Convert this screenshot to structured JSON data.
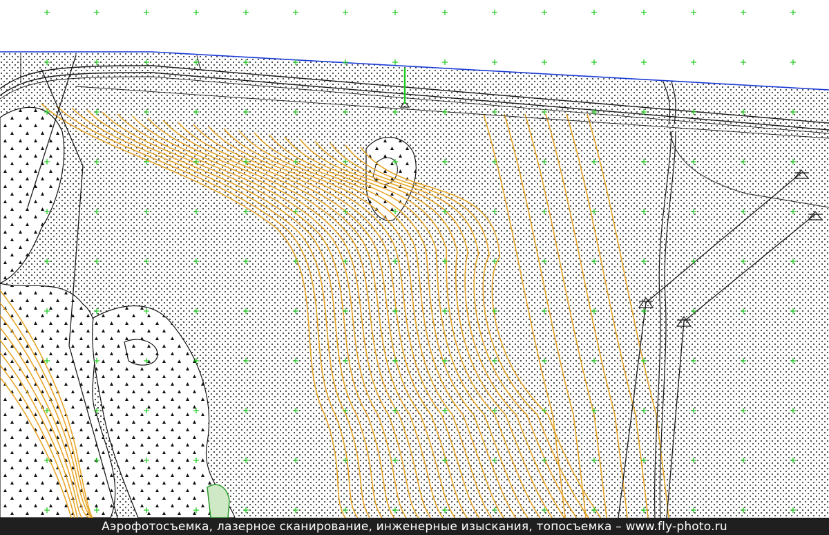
{
  "caption": "Аэрофотосъемка, лазерное сканирование, инженерные изыскания, топосъемка – www.fly-photo.ru",
  "colors": {
    "contour": "#e8a628",
    "grid_cross": "#22cc22",
    "linework": "#1a1a1a",
    "boundary": "#1a3bd6",
    "stipple": "#1a1a1a",
    "background": "#ffffff",
    "caption_bar": "#1f1f1f",
    "caption_text": "#ffffff"
  },
  "icons": [
    "power-pylon-icon",
    "grid-cross-icon",
    "tree-symbol-icon",
    "road-icon"
  ]
}
